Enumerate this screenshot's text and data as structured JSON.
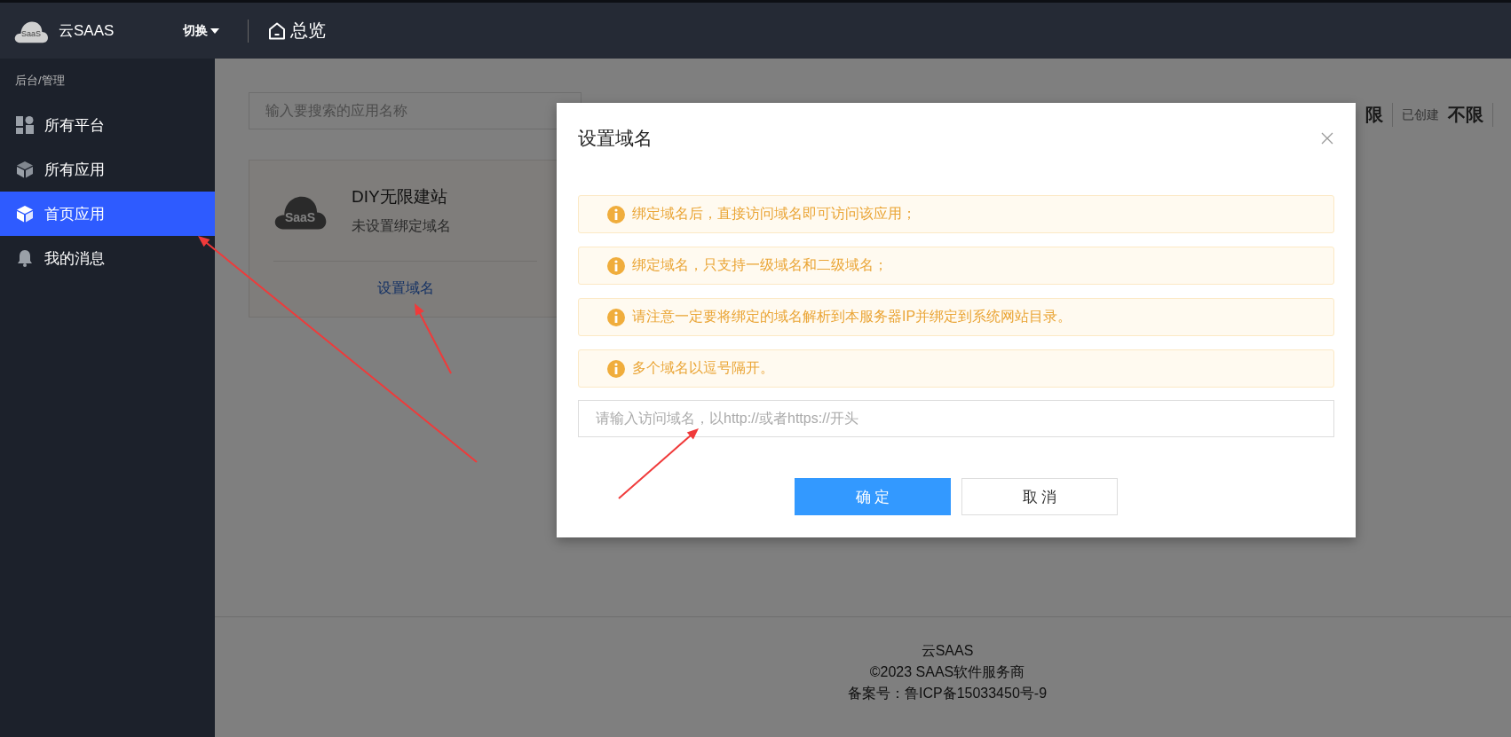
{
  "header": {
    "logo_text": "SaaS",
    "brand": "云SAAS",
    "switch": "切换",
    "overview": "总览"
  },
  "sidebar": {
    "breadcrumb": "后台/管理",
    "items": [
      {
        "label": "所有平台",
        "selected": false
      },
      {
        "label": "所有应用",
        "selected": false
      },
      {
        "label": "首页应用",
        "selected": true
      },
      {
        "label": "我的消息",
        "selected": false
      }
    ]
  },
  "search": {
    "placeholder": "输入要搜索的应用名称"
  },
  "stats": [
    {
      "value": "限"
    },
    {
      "label": "已创建",
      "value": "不限"
    }
  ],
  "app_card": {
    "logo_text": "SaaS",
    "name": "DIY无限建站",
    "domain_status": "未设置绑定域名",
    "action": "设置域名"
  },
  "footer": {
    "lines": [
      "云SAAS",
      "©2023 SAAS软件服务商",
      "备案号：鲁ICP备15033450号-9"
    ]
  },
  "modal": {
    "title": "设置域名",
    "notices": [
      "绑定域名后，直接访问域名即可访问该应用；",
      "绑定域名，只支持一级域名和二级域名；",
      "请注意一定要将绑定的域名解析到本服务器IP并绑定到系统网站目录。",
      "多个域名以逗号隔开。"
    ],
    "input": {
      "placeholder": "请输入访问域名，以http://或者https://开头"
    },
    "buttons": [
      {
        "label": "确 定",
        "kind": "primary"
      },
      {
        "label": "取 消",
        "kind": "default"
      }
    ]
  }
}
